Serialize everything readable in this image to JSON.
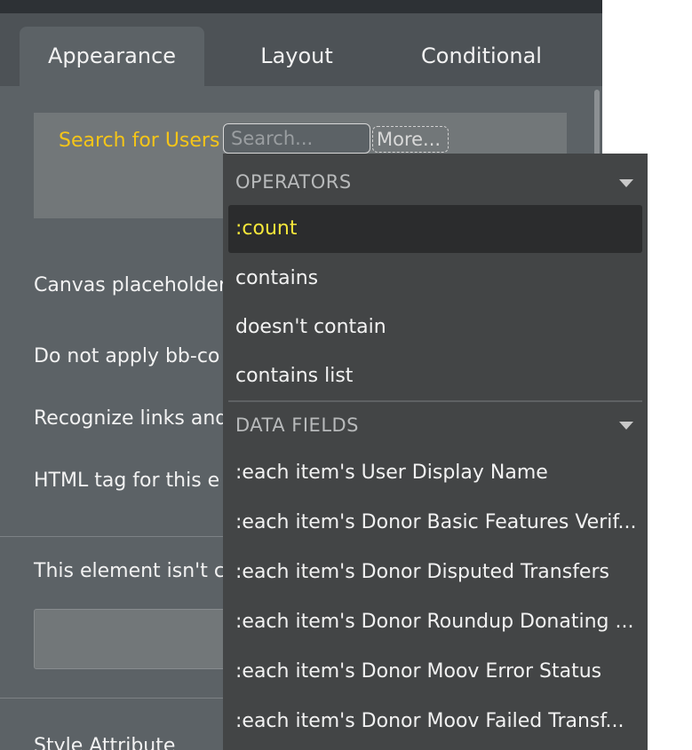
{
  "tabs": [
    {
      "label": "Appearance"
    },
    {
      "label": "Layout"
    },
    {
      "label": "Conditional"
    }
  ],
  "expression": {
    "source_label": "Search for Users",
    "search_placeholder": "Search...",
    "more_label": "More..."
  },
  "properties": {
    "canvas_placeholder": "Canvas placeholder",
    "bbcode": "Do not apply bb-co",
    "recognize_links": "Recognize links and",
    "html_tag": "HTML tag for this e",
    "not_connected": "This element isn't c",
    "style_attribute": "Style Attribute"
  },
  "dropdown": {
    "operators_header": "OPERATORS",
    "operators": [
      {
        "label": ":count"
      },
      {
        "label": "contains"
      },
      {
        "label": "doesn't contain"
      },
      {
        "label": "contains list"
      }
    ],
    "data_fields_header": "DATA FIELDS",
    "data_fields": [
      {
        "label": ":each item's User Display Name"
      },
      {
        "label": ":each item's Donor Basic Features Verif..."
      },
      {
        "label": ":each item's Donor Disputed Transfers"
      },
      {
        "label": ":each item's Donor Roundup Donating ..."
      },
      {
        "label": ":each item's Donor Moov Error Status"
      },
      {
        "label": ":each item's Donor Moov Failed Transf..."
      }
    ]
  },
  "colors": {
    "accent_yellow": "#f5c518",
    "selected_text": "#f5e63a",
    "panel_bg": "#5c6266",
    "dropdown_bg": "#434546"
  }
}
